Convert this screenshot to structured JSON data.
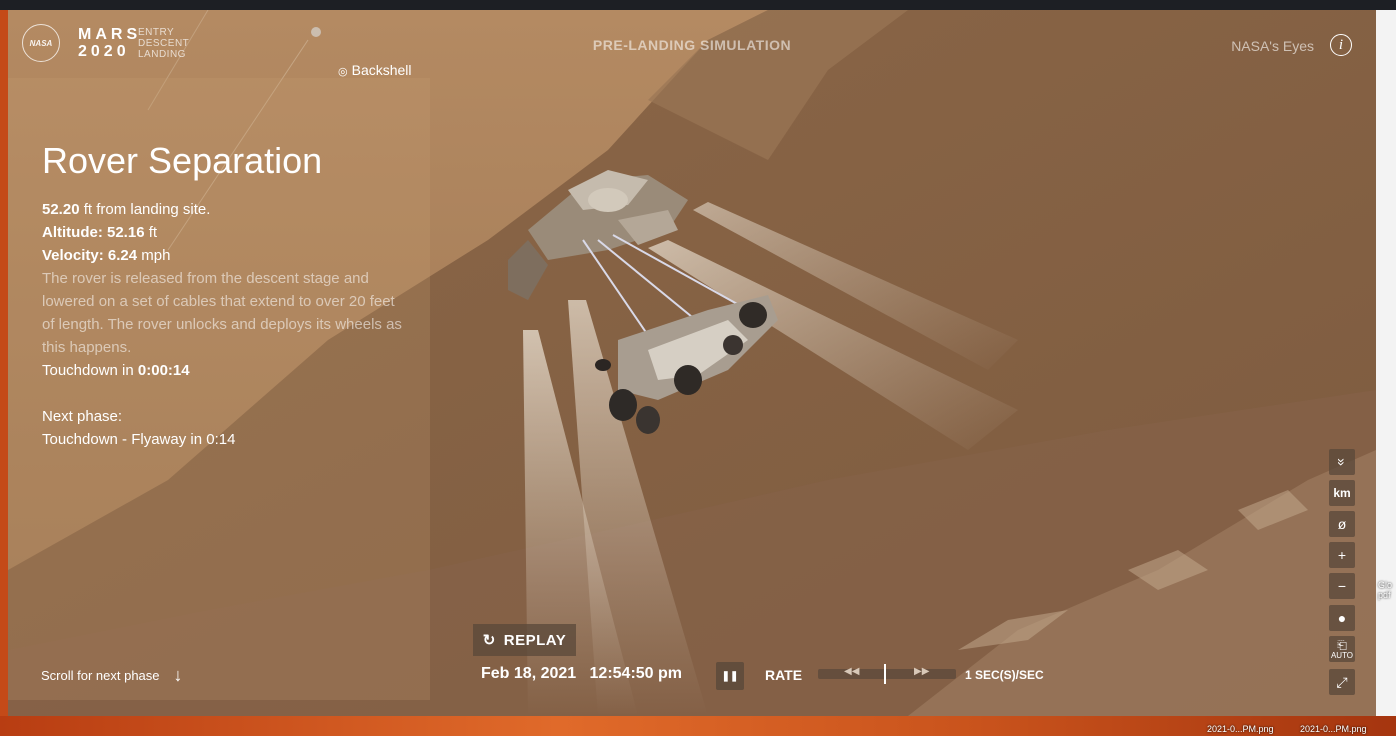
{
  "header": {
    "nasa_logo": "NASA",
    "mission_line1": "MARS",
    "mission_line2": "2020",
    "mission_sub": [
      "ENTRY",
      "DESCENT",
      "LANDING"
    ],
    "sim_title": "PRE-LANDING SIMULATION",
    "nasa_eyes_link": "NASA's Eyes",
    "info_icon": "i"
  },
  "scene": {
    "backshell_label": "Backshell",
    "backshell_icon": "target-icon"
  },
  "panel": {
    "phase_title": "Rover Separation",
    "distance_value": "52.20",
    "distance_text": " ft from landing site.",
    "altitude_label": "Altitude: ",
    "altitude_value": "52.16",
    "altitude_unit": " ft",
    "velocity_label": "Velocity: ",
    "velocity_value": "6.24",
    "velocity_unit": " mph",
    "description": "The rover is released from the descent stage and lowered on a set of cables that extend to over 20 feet of length. The rover unlocks and deploys its wheels as this happens.",
    "touchdown_label": "Touchdown in ",
    "touchdown_value": "0:00:14",
    "next_phase_label": "Next phase:",
    "next_phase_value": "Touchdown - Flyaway in 0:14",
    "scroll_hint": "Scroll for next phase",
    "scroll_icon": "↓"
  },
  "timeline": {
    "replay_icon": "↻",
    "replay_label": "REPLAY",
    "date": "Feb 18, 2021",
    "time": "12:54:50 pm",
    "pause_icon": "❚❚",
    "rate_label": "RATE",
    "rate_value": "1 SEC(S)/SEC",
    "rate_rewind_icon": "◀◀",
    "rate_ff_icon": "▶▶"
  },
  "controls": {
    "collapse_icon": "»",
    "units_label": "km",
    "visibility_icon": "ø",
    "zoom_in_icon": "+",
    "zoom_out_icon": "−",
    "dot_icon": "●",
    "auto_label": "AUTO",
    "fullscreen_icon": "⤢"
  },
  "desktop": {
    "file1": "2021-0...PM.png",
    "file2": "2021-0...PM.png",
    "edge_label": "Glo pdf"
  },
  "colors": {
    "sky": "#a97f5a",
    "terrain": "#8f6a48",
    "panel_overlay": "rgba(200,160,115,0.22)",
    "button_bg": "#5a483a"
  }
}
